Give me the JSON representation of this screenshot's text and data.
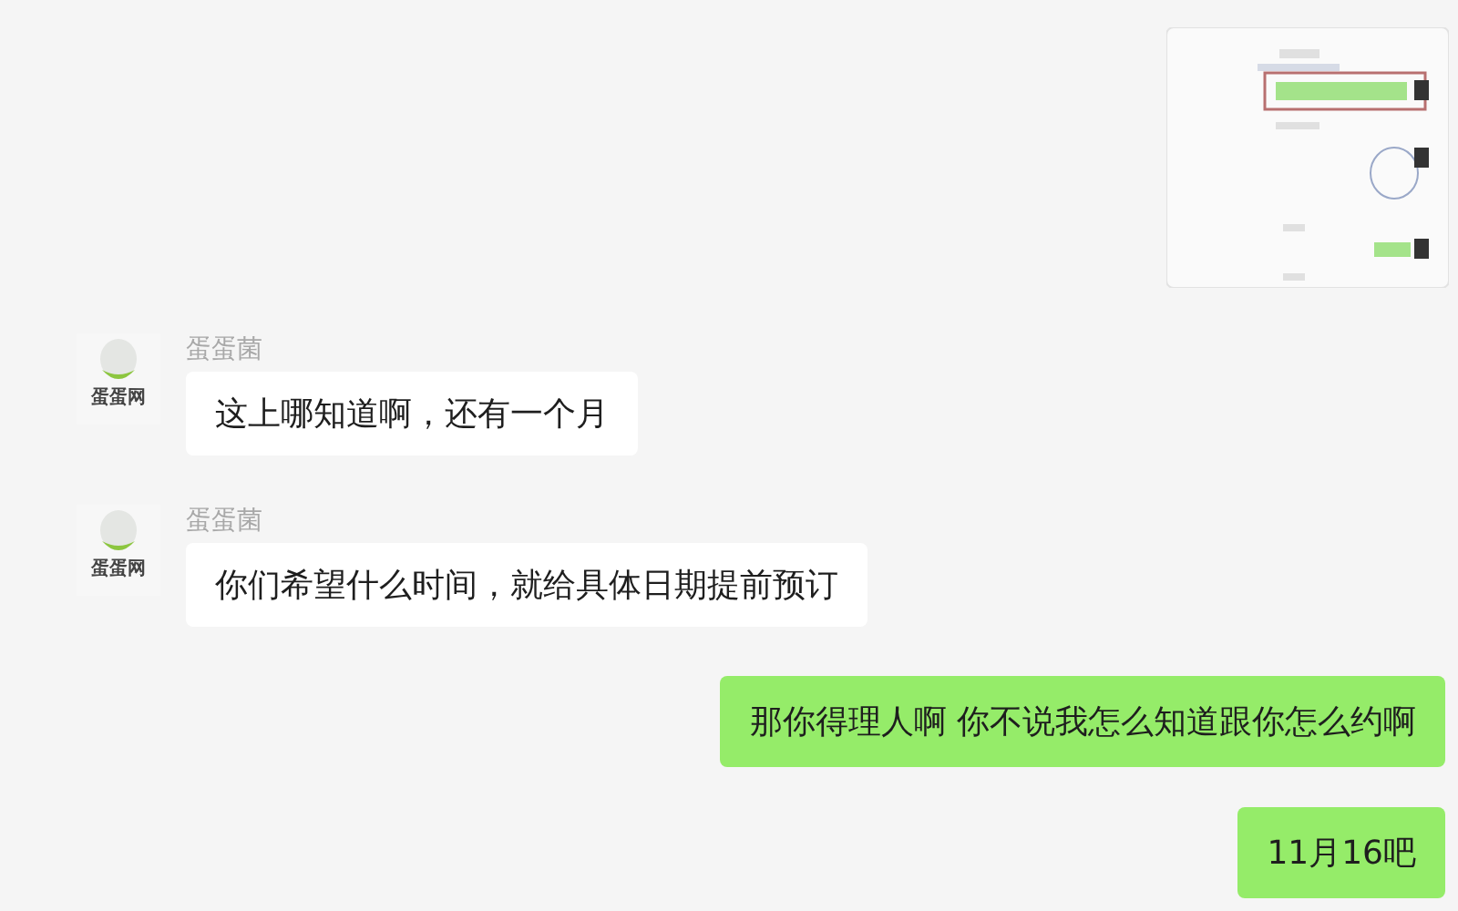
{
  "messages": [
    {
      "kind": "incoming",
      "sender": "蛋蛋菌",
      "avatar_label": "蛋蛋网",
      "text": "这上哪知道啊，还有一个月"
    },
    {
      "kind": "incoming",
      "sender": "蛋蛋菌",
      "avatar_label": "蛋蛋网",
      "text": "你们希望什么时间，就给具体日期提前预订"
    },
    {
      "kind": "outgoing",
      "text": "那你得理人啊 你不说我怎么知道跟你怎么约啊"
    },
    {
      "kind": "outgoing",
      "text": "11月16吧"
    }
  ]
}
